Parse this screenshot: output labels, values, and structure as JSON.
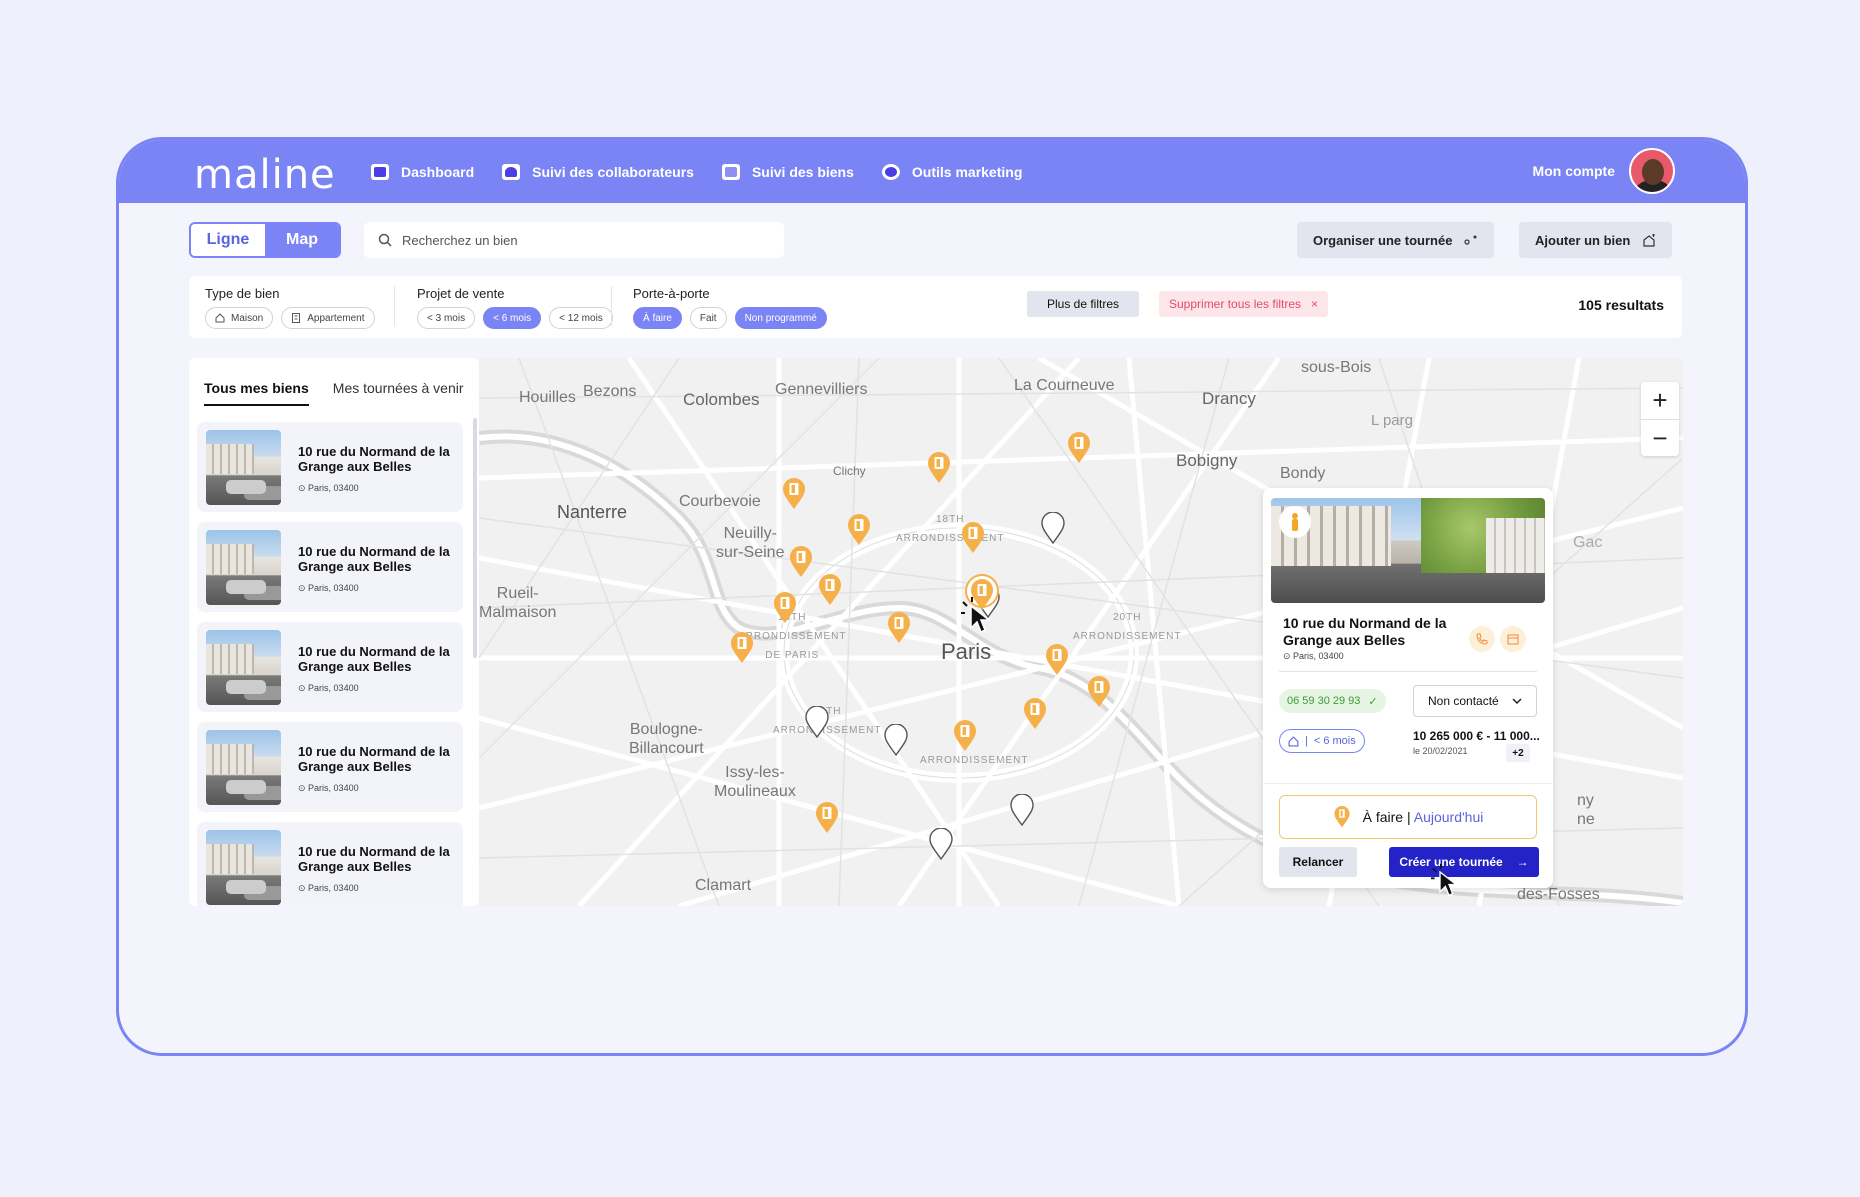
{
  "app": {
    "logo": "maline"
  },
  "nav": {
    "items": [
      {
        "label": "Dashboard"
      },
      {
        "label": "Suivi des collaborateurs"
      },
      {
        "label": "Suivi des biens"
      },
      {
        "label": "Outils marketing"
      }
    ],
    "account": "Mon compte"
  },
  "view_toggle": {
    "ligne": "Ligne",
    "map": "Map",
    "selected": "Map"
  },
  "search": {
    "placeholder": "Recherchez un bien"
  },
  "toolbar": {
    "organise": "Organiser une tournée",
    "add": "Ajouter un bien"
  },
  "filters": {
    "type_label": "Type de bien",
    "type_options": [
      "Maison",
      "Appartement"
    ],
    "projet_label": "Projet de vente",
    "projet_options": [
      "< 3 mois",
      "< 6 mois",
      "< 12 mois"
    ],
    "projet_selected": "< 6 mois",
    "porte_label": "Porte-à-porte",
    "porte_options": [
      "À faire",
      "Fait",
      "Non programmé"
    ],
    "porte_selected": [
      "À faire",
      "Non programmé"
    ],
    "more": "Plus de filtres",
    "clear": "Supprimer tous les filtres",
    "results": "105 resultats"
  },
  "list": {
    "tabs": [
      "Tous mes biens",
      "Mes tournées à venir"
    ],
    "active_tab": "Tous mes biens",
    "cards": [
      {
        "title": "10 rue du Normand de la Grange aux Belles",
        "address": "Paris, 03400"
      },
      {
        "title": "10 rue du Normand de la Grange aux Belles",
        "address": "Paris, 03400"
      },
      {
        "title": "10 rue du Normand de la Grange aux Belles",
        "address": "Paris, 03400"
      },
      {
        "title": "10 rue du Normand de la Grange aux Belles",
        "address": "Paris, 03400"
      },
      {
        "title": "10 rue du Normand de la Grange aux Belles",
        "address": "Paris, 03400"
      }
    ]
  },
  "map": {
    "labels": {
      "houilles": "Houilles",
      "bezons": "Bezons",
      "colombes": "Colombes",
      "gennevilliers": "Gennevilliers",
      "courneuve": "La Courneuve",
      "drancy": "Drancy",
      "sousbois": "sous-Bois",
      "bobigny": "Bobigny",
      "bondy": "Bondy",
      "clichy": "Clichy",
      "nanterre": "Nanterre",
      "courbevoie": "Courbevoie",
      "neuilly": "Neuilly-\nsur-Seine",
      "rueil": "Rueil-\nMalmaison",
      "arr18": "18TH\nARRONDISSEMENT",
      "arr16": "16TH\nARRONDISSEMENT\nDE PARIS",
      "paris": "Paris",
      "arr20": "20TH\nARRONDISSEMENT",
      "arr15": "15TH\nARRONDISSEMENT",
      "arr13": "ARRONDISSEMENT",
      "boulogne": "Boulogne-\nBillancourt",
      "issy": "Issy-les-\nMoulineaux",
      "clamart": "Clamart",
      "fosses": "des-Fosses",
      "l_parg": "L   parg",
      "gac": "Gac",
      "ny": "ny",
      "ne": "ne"
    },
    "zoom_in": "+",
    "zoom_out": "−"
  },
  "popup": {
    "title": "10 rue du Normand de la Grange aux Belles",
    "address": "Paris, 03400",
    "phone": "06 59 30 29 93",
    "status": "Non contacté",
    "tag": "< 6 mois",
    "price": "10 265 000 € - 11 000...",
    "date": "le 20/02/2021",
    "extra": "+2",
    "todo_status": "À faire",
    "todo_sep": "|",
    "todo_when": "Aujourd'hui",
    "relancer": "Relancer",
    "create": "Créer une tournée"
  },
  "colors": {
    "brand": "#7a84f5",
    "pin_orange": "#f5b04a",
    "cta": "#2323c7"
  }
}
